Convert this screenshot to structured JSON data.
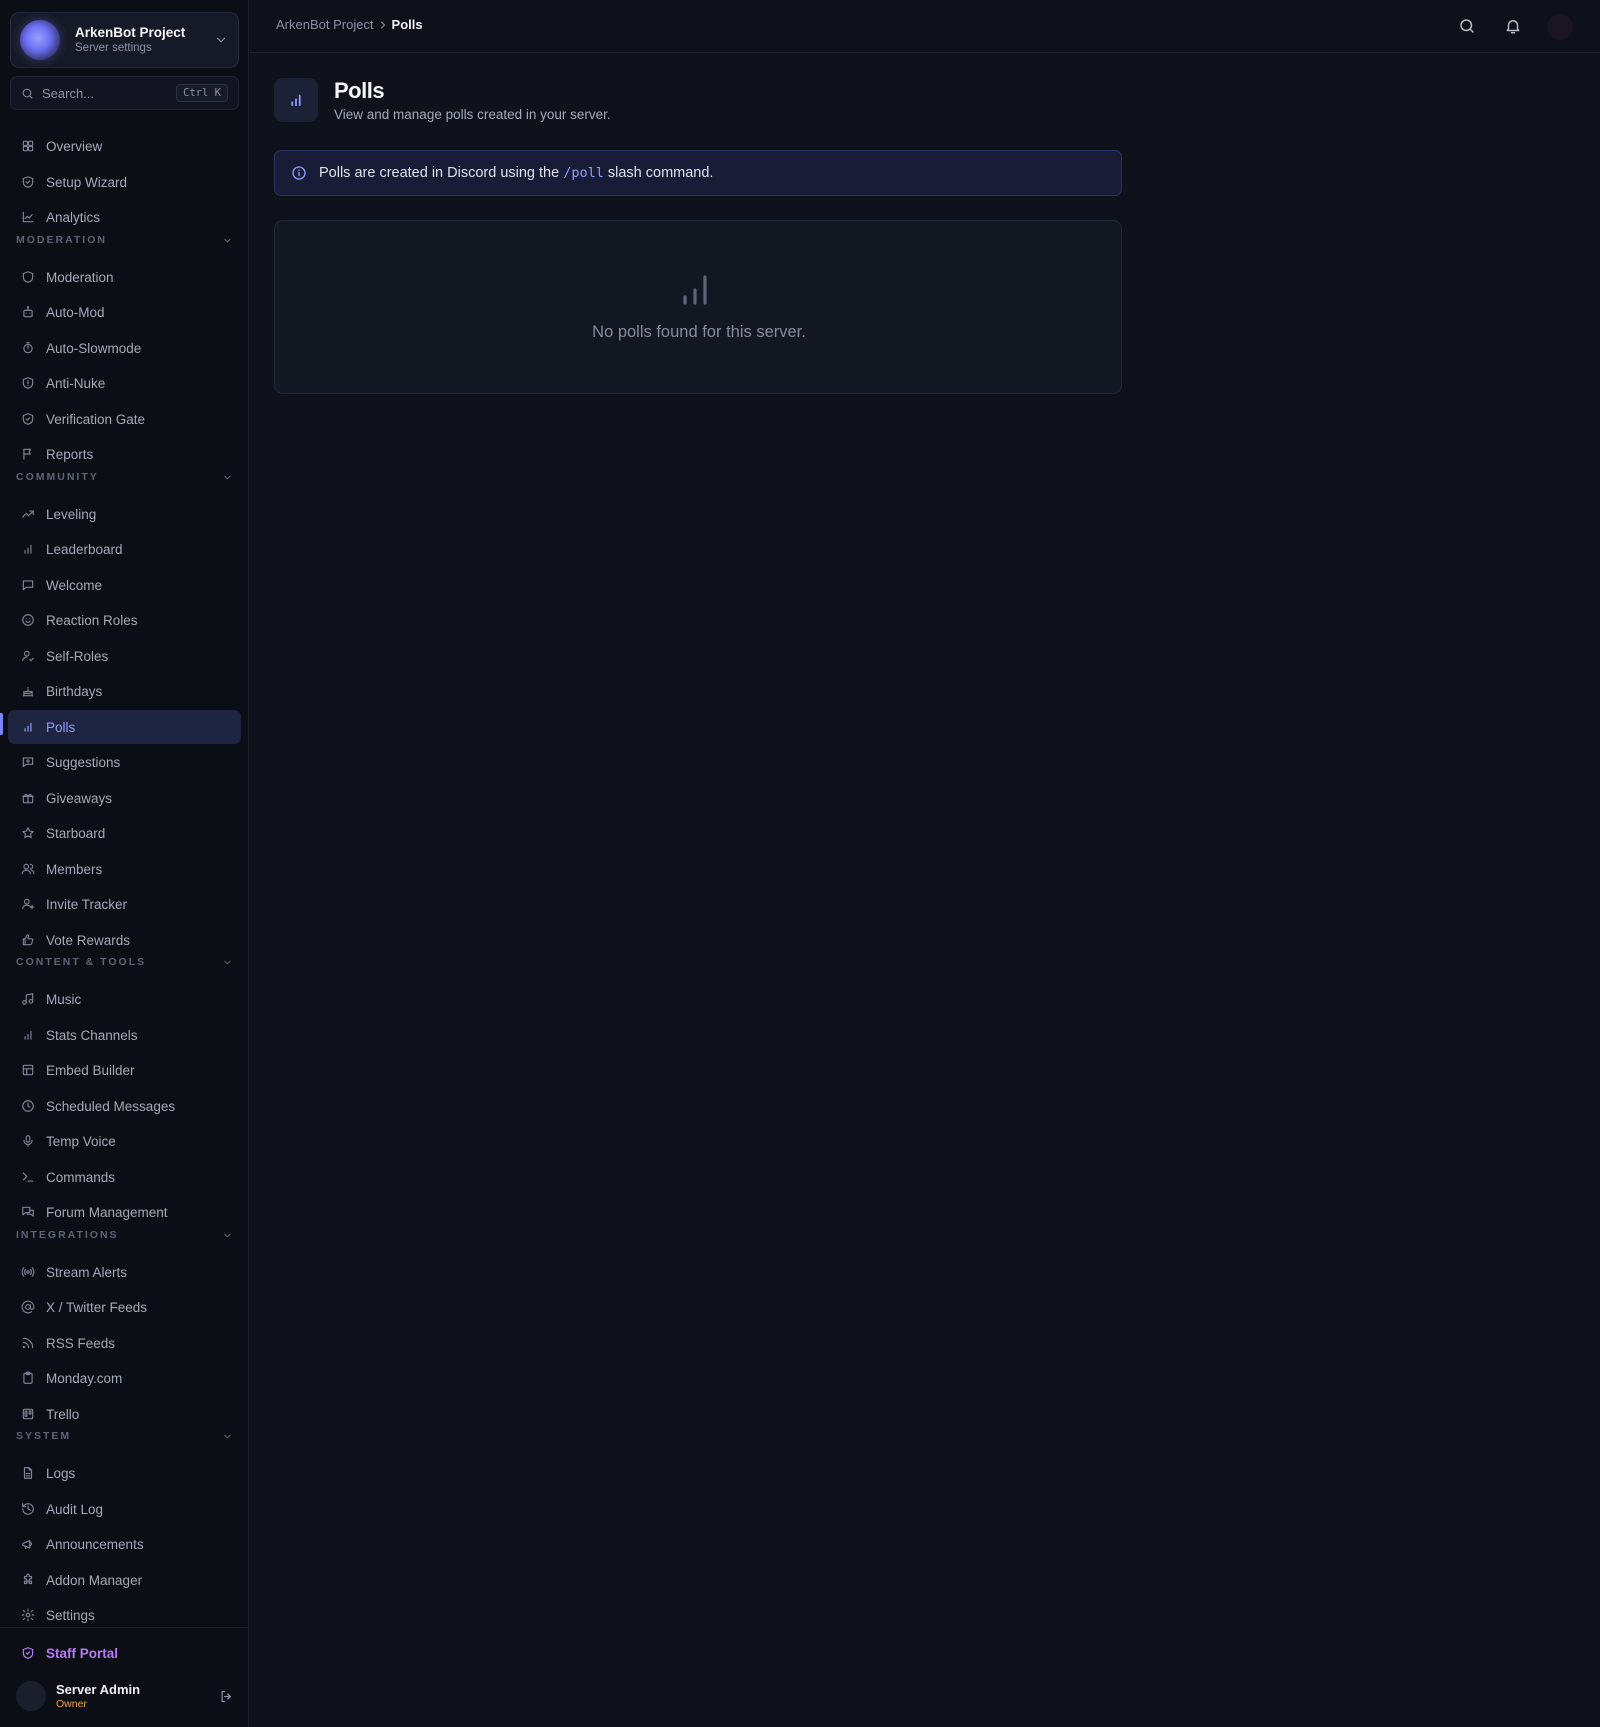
{
  "server": {
    "name": "ArkenBot Project",
    "subtitle": "Server settings"
  },
  "search": {
    "placeholder": "Search...",
    "shortcut": "Ctrl K"
  },
  "sidebar": {
    "top_items": [
      {
        "label": "Overview",
        "icon": "layout-grid-icon"
      },
      {
        "label": "Setup Wizard",
        "icon": "shield-check-icon"
      },
      {
        "label": "Analytics",
        "icon": "line-chart-icon"
      }
    ],
    "sections": [
      {
        "title": "MODERATION",
        "items": [
          {
            "label": "Moderation",
            "icon": "shield-icon"
          },
          {
            "label": "Auto-Mod",
            "icon": "bot-icon"
          },
          {
            "label": "Auto-Slowmode",
            "icon": "timer-icon"
          },
          {
            "label": "Anti-Nuke",
            "icon": "shield-alert-icon"
          },
          {
            "label": "Verification Gate",
            "icon": "shield-check-icon"
          },
          {
            "label": "Reports",
            "icon": "flag-icon"
          }
        ]
      },
      {
        "title": "COMMUNITY",
        "items": [
          {
            "label": "Leveling",
            "icon": "trending-up-icon"
          },
          {
            "label": "Leaderboard",
            "icon": "bar-chart-icon"
          },
          {
            "label": "Welcome",
            "icon": "message-square-icon"
          },
          {
            "label": "Reaction Roles",
            "icon": "smile-icon"
          },
          {
            "label": "Self-Roles",
            "icon": "user-check-icon"
          },
          {
            "label": "Birthdays",
            "icon": "cake-icon"
          },
          {
            "label": "Polls",
            "icon": "bar-chart-icon",
            "active": true
          },
          {
            "label": "Suggestions",
            "icon": "message-square-plus-icon"
          },
          {
            "label": "Giveaways",
            "icon": "gift-icon"
          },
          {
            "label": "Starboard",
            "icon": "star-icon"
          },
          {
            "label": "Members",
            "icon": "users-icon"
          },
          {
            "label": "Invite Tracker",
            "icon": "user-plus-icon"
          },
          {
            "label": "Vote Rewards",
            "icon": "thumbs-up-icon"
          }
        ]
      },
      {
        "title": "CONTENT & TOOLS",
        "items": [
          {
            "label": "Music",
            "icon": "music-icon"
          },
          {
            "label": "Stats Channels",
            "icon": "bar-chart-icon"
          },
          {
            "label": "Embed Builder",
            "icon": "layout-icon"
          },
          {
            "label": "Scheduled Messages",
            "icon": "clock-icon"
          },
          {
            "label": "Temp Voice",
            "icon": "mic-icon"
          },
          {
            "label": "Commands",
            "icon": "terminal-icon"
          },
          {
            "label": "Forum Management",
            "icon": "messages-icon"
          }
        ]
      },
      {
        "title": "INTEGRATIONS",
        "items": [
          {
            "label": "Stream Alerts",
            "icon": "radio-icon"
          },
          {
            "label": "X / Twitter Feeds",
            "icon": "at-sign-icon"
          },
          {
            "label": "RSS Feeds",
            "icon": "rss-icon"
          },
          {
            "label": "Monday.com",
            "icon": "clipboard-icon"
          },
          {
            "label": "Trello",
            "icon": "trello-icon"
          }
        ]
      },
      {
        "title": "SYSTEM",
        "items": [
          {
            "label": "Logs",
            "icon": "file-text-icon"
          },
          {
            "label": "Audit Log",
            "icon": "history-icon"
          },
          {
            "label": "Announcements",
            "icon": "megaphone-icon"
          },
          {
            "label": "Addon Manager",
            "icon": "puzzle-icon"
          },
          {
            "label": "Settings",
            "icon": "gear-icon"
          }
        ]
      }
    ]
  },
  "staff_portal": {
    "label": "Staff Portal"
  },
  "user": {
    "name": "Server Admin",
    "role": "Owner"
  },
  "breadcrumb": {
    "root": "ArkenBot Project",
    "current": "Polls"
  },
  "page": {
    "title": "Polls",
    "subtitle": "View and manage polls created in your server."
  },
  "info": {
    "before": "Polls are created in Discord using the ",
    "code": "/poll",
    "after": " slash command."
  },
  "empty_state": {
    "text": "No polls found for this server."
  },
  "colors": {
    "accent": "#8f9bff",
    "staff": "#b879f5",
    "owner": "#f0a53a",
    "background": "#0f121b"
  }
}
